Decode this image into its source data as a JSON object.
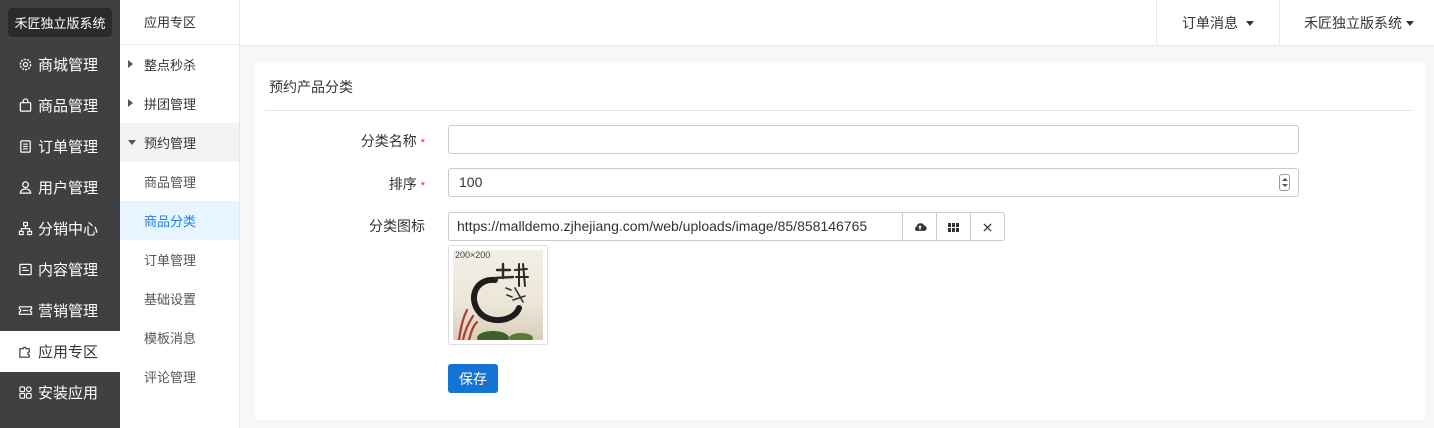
{
  "brand": {
    "title": "禾匠独立版系统"
  },
  "sidebar": {
    "items": [
      {
        "label": "商城管理",
        "icon": "gear-icon"
      },
      {
        "label": "商品管理",
        "icon": "bag-icon"
      },
      {
        "label": "订单管理",
        "icon": "document-icon"
      },
      {
        "label": "用户管理",
        "icon": "user-icon"
      },
      {
        "label": "分销中心",
        "icon": "network-icon"
      },
      {
        "label": "内容管理",
        "icon": "content-icon"
      },
      {
        "label": "营销管理",
        "icon": "ticket-icon"
      },
      {
        "label": "应用专区",
        "icon": "puzzle-icon",
        "active": true
      },
      {
        "label": "安装应用",
        "icon": "grid-icon"
      }
    ]
  },
  "subnav": {
    "title": "应用专区",
    "groups": [
      {
        "label": "整点秒杀"
      },
      {
        "label": "拼团管理"
      },
      {
        "label": "预约管理"
      }
    ],
    "children": [
      {
        "label": "商品管理"
      },
      {
        "label": "商品分类",
        "selected": true
      },
      {
        "label": "订单管理"
      },
      {
        "label": "基础设置"
      },
      {
        "label": "模板消息"
      },
      {
        "label": "评论管理"
      }
    ]
  },
  "header": {
    "order_messages": "订单消息",
    "account": "禾匠独立版系统"
  },
  "form": {
    "title": "预约产品分类",
    "name_label": "分类名称",
    "name_value": "",
    "required_mark": "*",
    "sort_label": "排序",
    "sort_value": "100",
    "icon_label": "分类图标",
    "icon_url": "https://malldemo.zjhejiang.com/web/uploads/image/85/858146765",
    "thumb_size": "200×200",
    "save_label": "保存"
  },
  "colors": {
    "sidebar_bg": "#404040",
    "selected_bg": "#e8f4ff",
    "selected_text": "#2281e6",
    "primary": "#1573d1",
    "required": "#e02d2d"
  }
}
